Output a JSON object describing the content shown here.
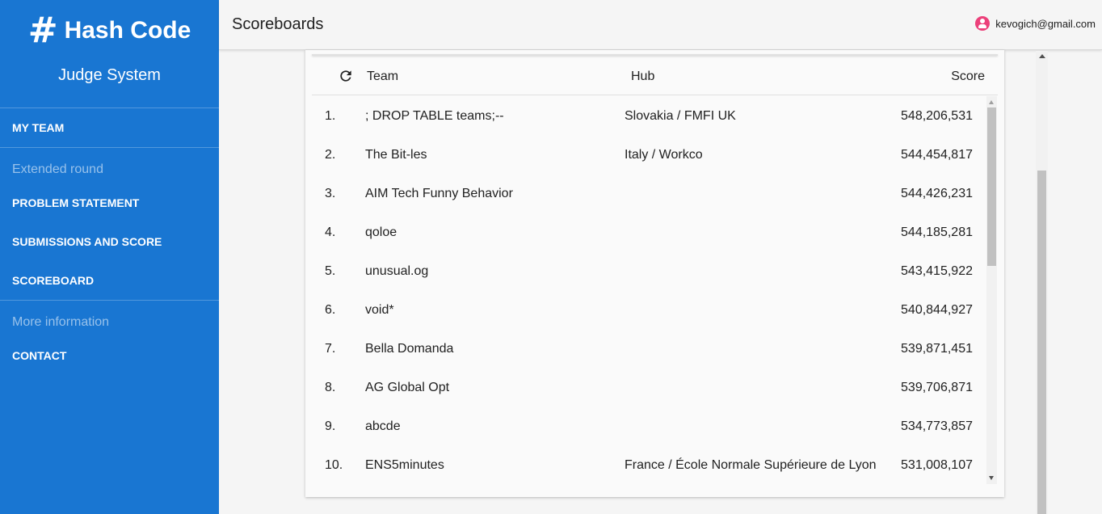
{
  "sidebar": {
    "brand_icon": "#",
    "brand_title": "Hash Code",
    "brand_subtitle": "Judge System",
    "my_team": "MY TEAM",
    "section_extended": "Extended round",
    "problem_statement": "PROBLEM STATEMENT",
    "submissions": "SUBMISSIONS AND SCORE",
    "scoreboard": "SCOREBOARD",
    "section_more": "More information",
    "contact": "CONTACT",
    "color": "#1976d2"
  },
  "header": {
    "title": "Scoreboards",
    "user_email": "kevogich@gmail.com",
    "avatar_color": "#ec407a"
  },
  "table": {
    "col_team": "Team",
    "col_hub": "Hub",
    "col_score": "Score",
    "rows": [
      {
        "rank": "1.",
        "team": "; DROP TABLE teams;--",
        "hub": "Slovakia / FMFI UK",
        "score": "548,206,531"
      },
      {
        "rank": "2.",
        "team": "The Bit-les",
        "hub": "Italy / Workco",
        "score": "544,454,817"
      },
      {
        "rank": "3.",
        "team": "AIM Tech Funny Behavior",
        "hub": "",
        "score": "544,426,231"
      },
      {
        "rank": "4.",
        "team": "qoloe",
        "hub": "",
        "score": "544,185,281"
      },
      {
        "rank": "5.",
        "team": "unusual.og",
        "hub": "",
        "score": "543,415,922"
      },
      {
        "rank": "6.",
        "team": "void*",
        "hub": "",
        "score": "540,844,927"
      },
      {
        "rank": "7.",
        "team": "Bella Domanda",
        "hub": "",
        "score": "539,871,451"
      },
      {
        "rank": "8.",
        "team": "AG Global Opt",
        "hub": "",
        "score": "539,706,871"
      },
      {
        "rank": "9.",
        "team": "abcde",
        "hub": "",
        "score": "534,773,857"
      },
      {
        "rank": "10.",
        "team": "ENS5minutes",
        "hub": "France / École Normale Supérieure de Lyon",
        "score": "531,008,107"
      }
    ]
  }
}
